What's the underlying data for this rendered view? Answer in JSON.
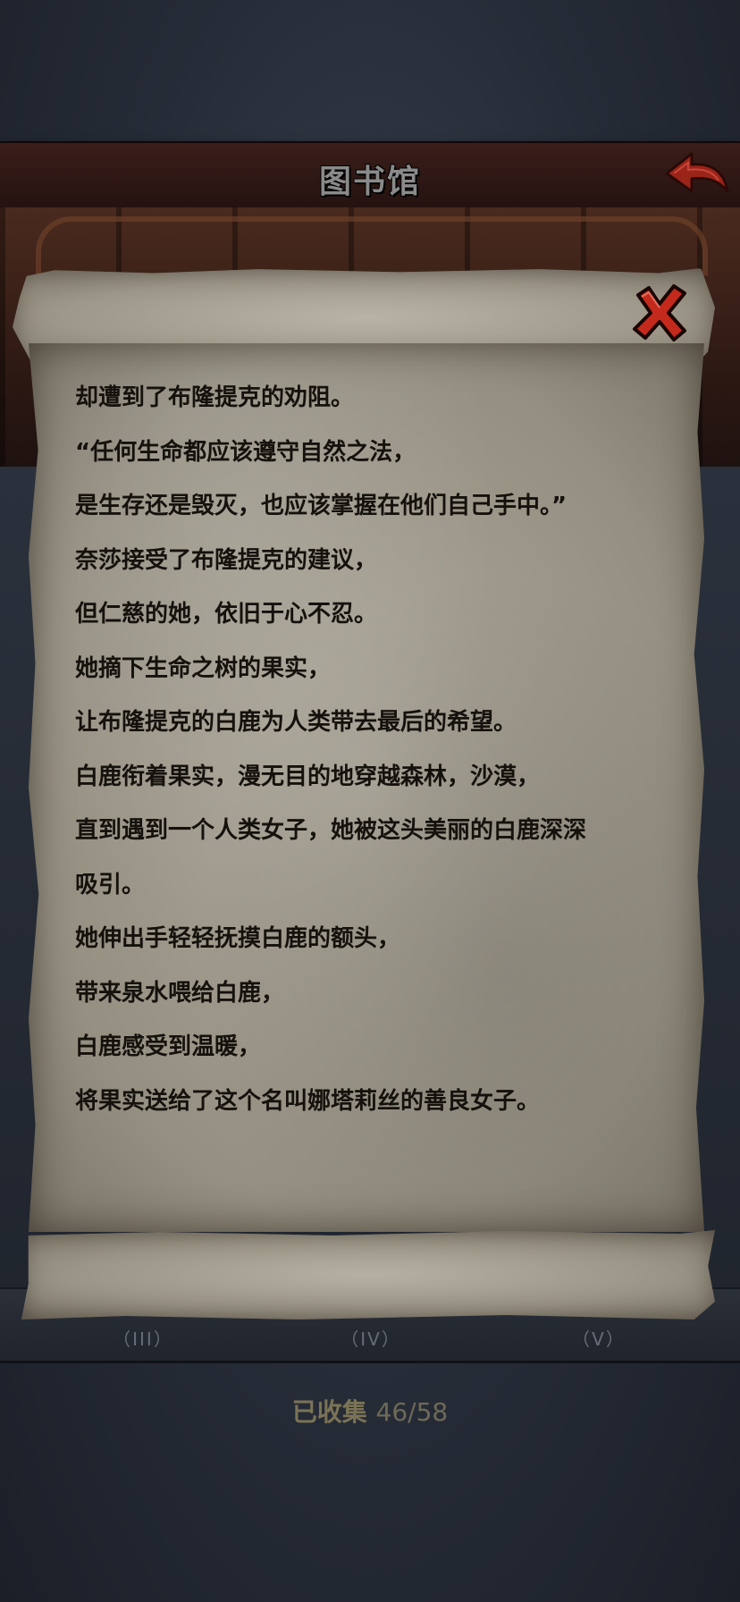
{
  "header": {
    "title": "图书馆"
  },
  "story": {
    "lines": [
      "却遭到了布隆提克的劝阻。",
      "“任何生命都应该遵守自然之法，",
      "是生存还是毁灭，也应该掌握在他们自己手中。”",
      "奈莎接受了布隆提克的建议，",
      "但仁慈的她，依旧于心不忍。",
      "她摘下生命之树的果实，",
      "让布隆提克的白鹿为人类带去最后的希望。",
      "白鹿衔着果实，漫无目的地穿越森林，沙漠，",
      "直到遇到一个人类女子，她被这头美丽的白鹿深深",
      "吸引。",
      "她伸出手轻轻抚摸白鹿的额头，",
      "带来泉水喂给白鹿，",
      "白鹿感受到温暖，",
      "将果实送给了这个名叫娜塔莉丝的善良女子。"
    ]
  },
  "gallery": {
    "labels": [
      "（III）",
      "（IV）",
      "（V）"
    ]
  },
  "footer": {
    "collected_label": "已收集",
    "collected_value": "46/58"
  },
  "icons": {
    "back": "back-arrow-icon",
    "close": "close-x-icon"
  },
  "colors": {
    "parchment": "#a39e91",
    "ink": "#15110c",
    "close_red": "#c42a1c",
    "header": "#2d1814"
  }
}
